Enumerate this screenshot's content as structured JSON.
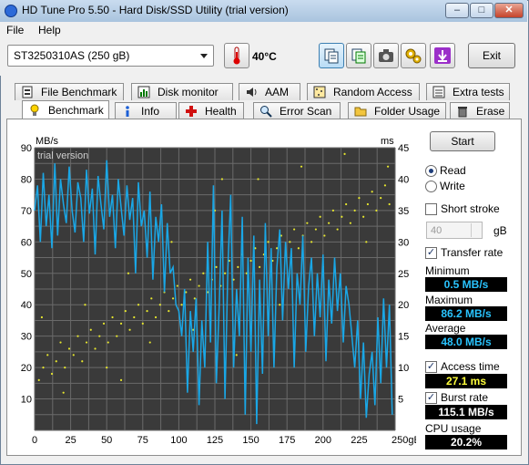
{
  "window": {
    "title": "HD Tune Pro 5.50 - Hard Disk/SSD Utility (trial version)"
  },
  "menu": {
    "file": "File",
    "help": "Help"
  },
  "toolbar": {
    "drive": "ST3250310AS (250 gB)",
    "temperature": "40°C",
    "exit": "Exit"
  },
  "tabs_top": [
    "File Benchmark",
    "Disk monitor",
    "AAM",
    "Random Access",
    "Extra tests"
  ],
  "tabs_bottom": [
    "Benchmark",
    "Info",
    "Health",
    "Error Scan",
    "Folder Usage",
    "Erase"
  ],
  "controls": {
    "start": "Start",
    "read": "Read",
    "write": "Write",
    "short_stroke": "Short stroke",
    "stroke_value": "40",
    "stroke_unit": "gB",
    "transfer_rate": "Transfer rate",
    "access_time": "Access time",
    "burst_rate": "Burst rate"
  },
  "stats": {
    "minimum_label": "Minimum",
    "minimum": "0.5 MB/s",
    "maximum_label": "Maximum",
    "maximum": "86.2 MB/s",
    "average_label": "Average",
    "average": "48.0 MB/s",
    "access_time": "27.1 ms",
    "burst_rate": "115.1 MB/s",
    "cpu_label": "CPU usage",
    "cpu_usage": "20.2%"
  },
  "colors": {
    "transfer_line": "#1aa7e6",
    "access_points": "#e6e62e",
    "chart_bg": "#3a3a3a",
    "grid": "#6a6a6a"
  },
  "chart_data": {
    "type": "line",
    "watermark": "trial version",
    "ylabel_left": "MB/s",
    "ylabel_right": "ms",
    "xlabel_unit": "gB",
    "xlim": [
      0,
      250
    ],
    "ylim_left": [
      0,
      90
    ],
    "ylim_right": [
      0,
      45
    ],
    "x_ticks": [
      "0",
      "25",
      "50",
      "75",
      "100",
      "125",
      "150",
      "175",
      "200",
      "225",
      "250gB"
    ],
    "y_ticks_left": [
      "90",
      "80",
      "70",
      "60",
      "50",
      "40",
      "30",
      "20",
      "10"
    ],
    "y_ticks_right": [
      "45",
      "40",
      "35",
      "30",
      "25",
      "20",
      "15",
      "10",
      "5"
    ],
    "series": [
      {
        "name": "Transfer rate",
        "axis": "left",
        "x": [
          0,
          2,
          4,
          6,
          8,
          10,
          12,
          14,
          16,
          18,
          20,
          22,
          24,
          26,
          28,
          30,
          32,
          34,
          36,
          38,
          40,
          42,
          44,
          46,
          48,
          50,
          52,
          54,
          56,
          58,
          60,
          62,
          64,
          66,
          68,
          70,
          72,
          74,
          76,
          78,
          80,
          82,
          84,
          86,
          88,
          90,
          92,
          94,
          96,
          98,
          100,
          102,
          104,
          106,
          108,
          110,
          112,
          114,
          116,
          118,
          120,
          122,
          124,
          126,
          128,
          130,
          132,
          134,
          136,
          138,
          140,
          142,
          144,
          146,
          148,
          150,
          152,
          154,
          156,
          158,
          160,
          162,
          164,
          166,
          168,
          170,
          172,
          174,
          176,
          178,
          180,
          182,
          184,
          186,
          188,
          190,
          192,
          194,
          196,
          198,
          200,
          202,
          204,
          206,
          208,
          210,
          212,
          214,
          216,
          218,
          220,
          222,
          224,
          226,
          228,
          230,
          232,
          234,
          236,
          238,
          240,
          242,
          244,
          246,
          248
        ],
        "values": [
          70,
          78,
          60,
          82,
          65,
          75,
          58,
          85,
          62,
          80,
          72,
          66,
          84,
          70,
          63,
          79,
          74,
          60,
          83,
          69,
          77,
          56,
          81,
          72,
          64,
          86,
          68,
          75,
          58,
          80,
          71,
          62,
          78,
          67,
          74,
          50,
          79,
          65,
          70,
          55,
          76,
          48,
          68,
          60,
          72,
          44,
          66,
          50,
          52,
          40,
          38,
          30,
          45,
          12,
          38,
          25,
          42,
          8,
          35,
          20,
          60,
          28,
          78,
          15,
          40,
          70,
          10,
          52,
          75,
          20,
          45,
          30,
          68,
          5,
          55,
          25,
          62,
          2,
          48,
          18,
          66,
          30,
          58,
          20,
          52,
          64,
          35,
          60,
          45,
          58,
          20,
          50,
          40,
          62,
          25,
          46,
          55,
          30,
          50,
          36,
          56,
          22,
          48,
          34,
          55,
          38,
          50,
          28,
          46,
          40,
          30,
          20,
          35,
          10,
          28,
          4,
          18,
          25,
          8,
          36,
          15,
          42,
          20,
          40,
          5
        ]
      },
      {
        "name": "Access time",
        "axis": "right",
        "x": [
          3,
          6,
          9,
          12,
          15,
          18,
          21,
          24,
          27,
          30,
          33,
          36,
          39,
          42,
          45,
          48,
          51,
          54,
          57,
          60,
          63,
          66,
          69,
          72,
          75,
          78,
          81,
          84,
          87,
          90,
          93,
          96,
          99,
          102,
          105,
          108,
          111,
          114,
          117,
          120,
          123,
          126,
          129,
          132,
          135,
          138,
          141,
          144,
          147,
          150,
          153,
          156,
          159,
          162,
          165,
          168,
          171,
          174,
          177,
          180,
          183,
          186,
          189,
          192,
          195,
          198,
          201,
          204,
          207,
          210,
          213,
          216,
          219,
          222,
          225,
          228,
          231,
          234,
          237,
          240,
          243,
          246,
          5,
          20,
          35,
          50,
          65,
          80,
          95,
          110,
          125,
          140,
          155,
          170,
          185,
          200,
          215,
          230,
          245,
          60,
          130
        ],
        "values": [
          8,
          10,
          12,
          9,
          11,
          14,
          10,
          13,
          12,
          15,
          11,
          14,
          16,
          13,
          15,
          17,
          14,
          18,
          15,
          17,
          19,
          16,
          18,
          20,
          17,
          19,
          21,
          18,
          20,
          22,
          19,
          21,
          23,
          20,
          22,
          24,
          21,
          23,
          25,
          22,
          24,
          26,
          23,
          25,
          27,
          24,
          26,
          28,
          25,
          27,
          29,
          26,
          28,
          30,
          27,
          29,
          31,
          28,
          30,
          32,
          29,
          31,
          33,
          30,
          32,
          34,
          31,
          33,
          35,
          32,
          34,
          36,
          33,
          35,
          37,
          34,
          36,
          38,
          35,
          37,
          39,
          36,
          18,
          6,
          20,
          10,
          25,
          14,
          30,
          16,
          35,
          12,
          40,
          20,
          42,
          26,
          44,
          30,
          42,
          8,
          40
        ]
      }
    ]
  }
}
